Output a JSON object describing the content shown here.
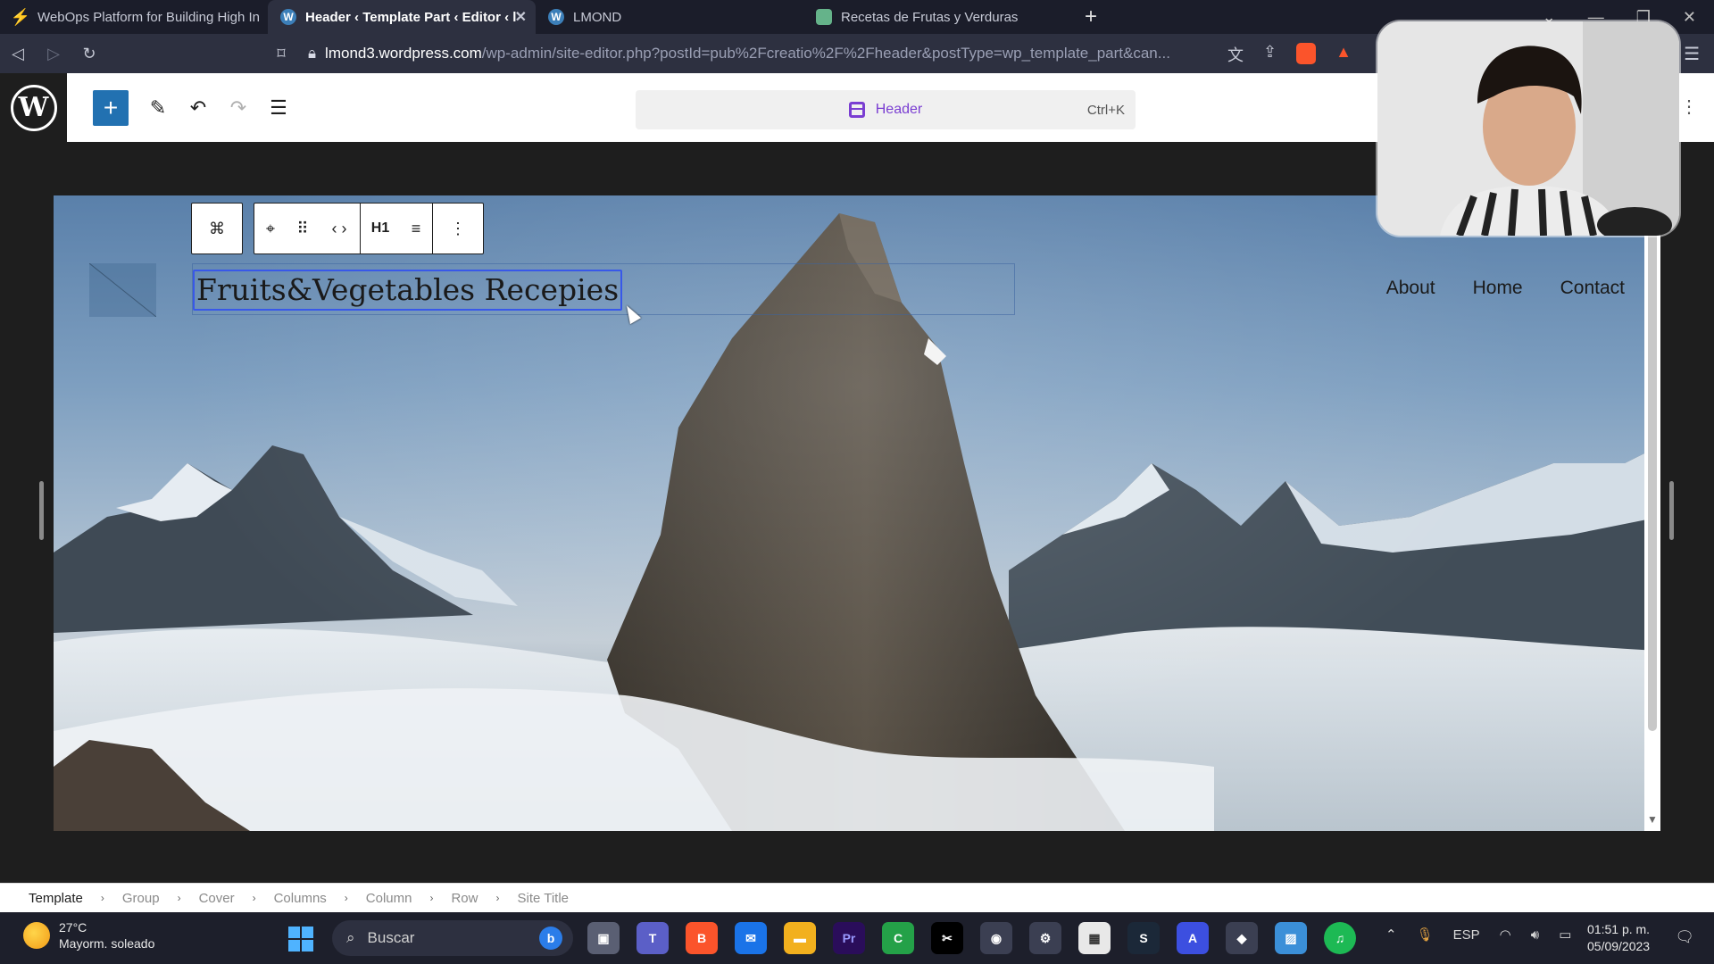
{
  "browser": {
    "tabs": [
      {
        "title": "WebOps Platform for Building High In",
        "active": false
      },
      {
        "title": "Header ‹ Template Part ‹ Editor ‹ l",
        "active": true
      },
      {
        "title": "LMOND",
        "active": false
      },
      {
        "title": "Recetas de Frutas y Verduras",
        "active": false
      }
    ],
    "new_tab": "+",
    "url_host": "lmond3.wordpress.com",
    "url_path": "/wp-admin/site-editor.php?postId=pub%2Fcreatio%2F%2Fheader&postType=wp_template_part&can..."
  },
  "editor": {
    "document_title": "Header",
    "shortcut": "Ctrl+K"
  },
  "site": {
    "title": "Fruits&Vegetables Recepies",
    "nav": [
      "About",
      "Home",
      "Contact"
    ]
  },
  "block_toolbar": {
    "heading_level": "H1"
  },
  "breadcrumbs": [
    "Template",
    "Group",
    "Cover",
    "Columns",
    "Column",
    "Row",
    "Site Title"
  ],
  "taskbar": {
    "weather_temp": "27°C",
    "weather_desc": "Mayorm. soleado",
    "search_placeholder": "Buscar",
    "language": "ESP",
    "time": "01:51 p. m.",
    "date": "05/09/2023"
  },
  "colors": {
    "wp_blue": "#2271b1",
    "selection_blue": "#3858e9",
    "template_purple": "#7a3ed2"
  }
}
